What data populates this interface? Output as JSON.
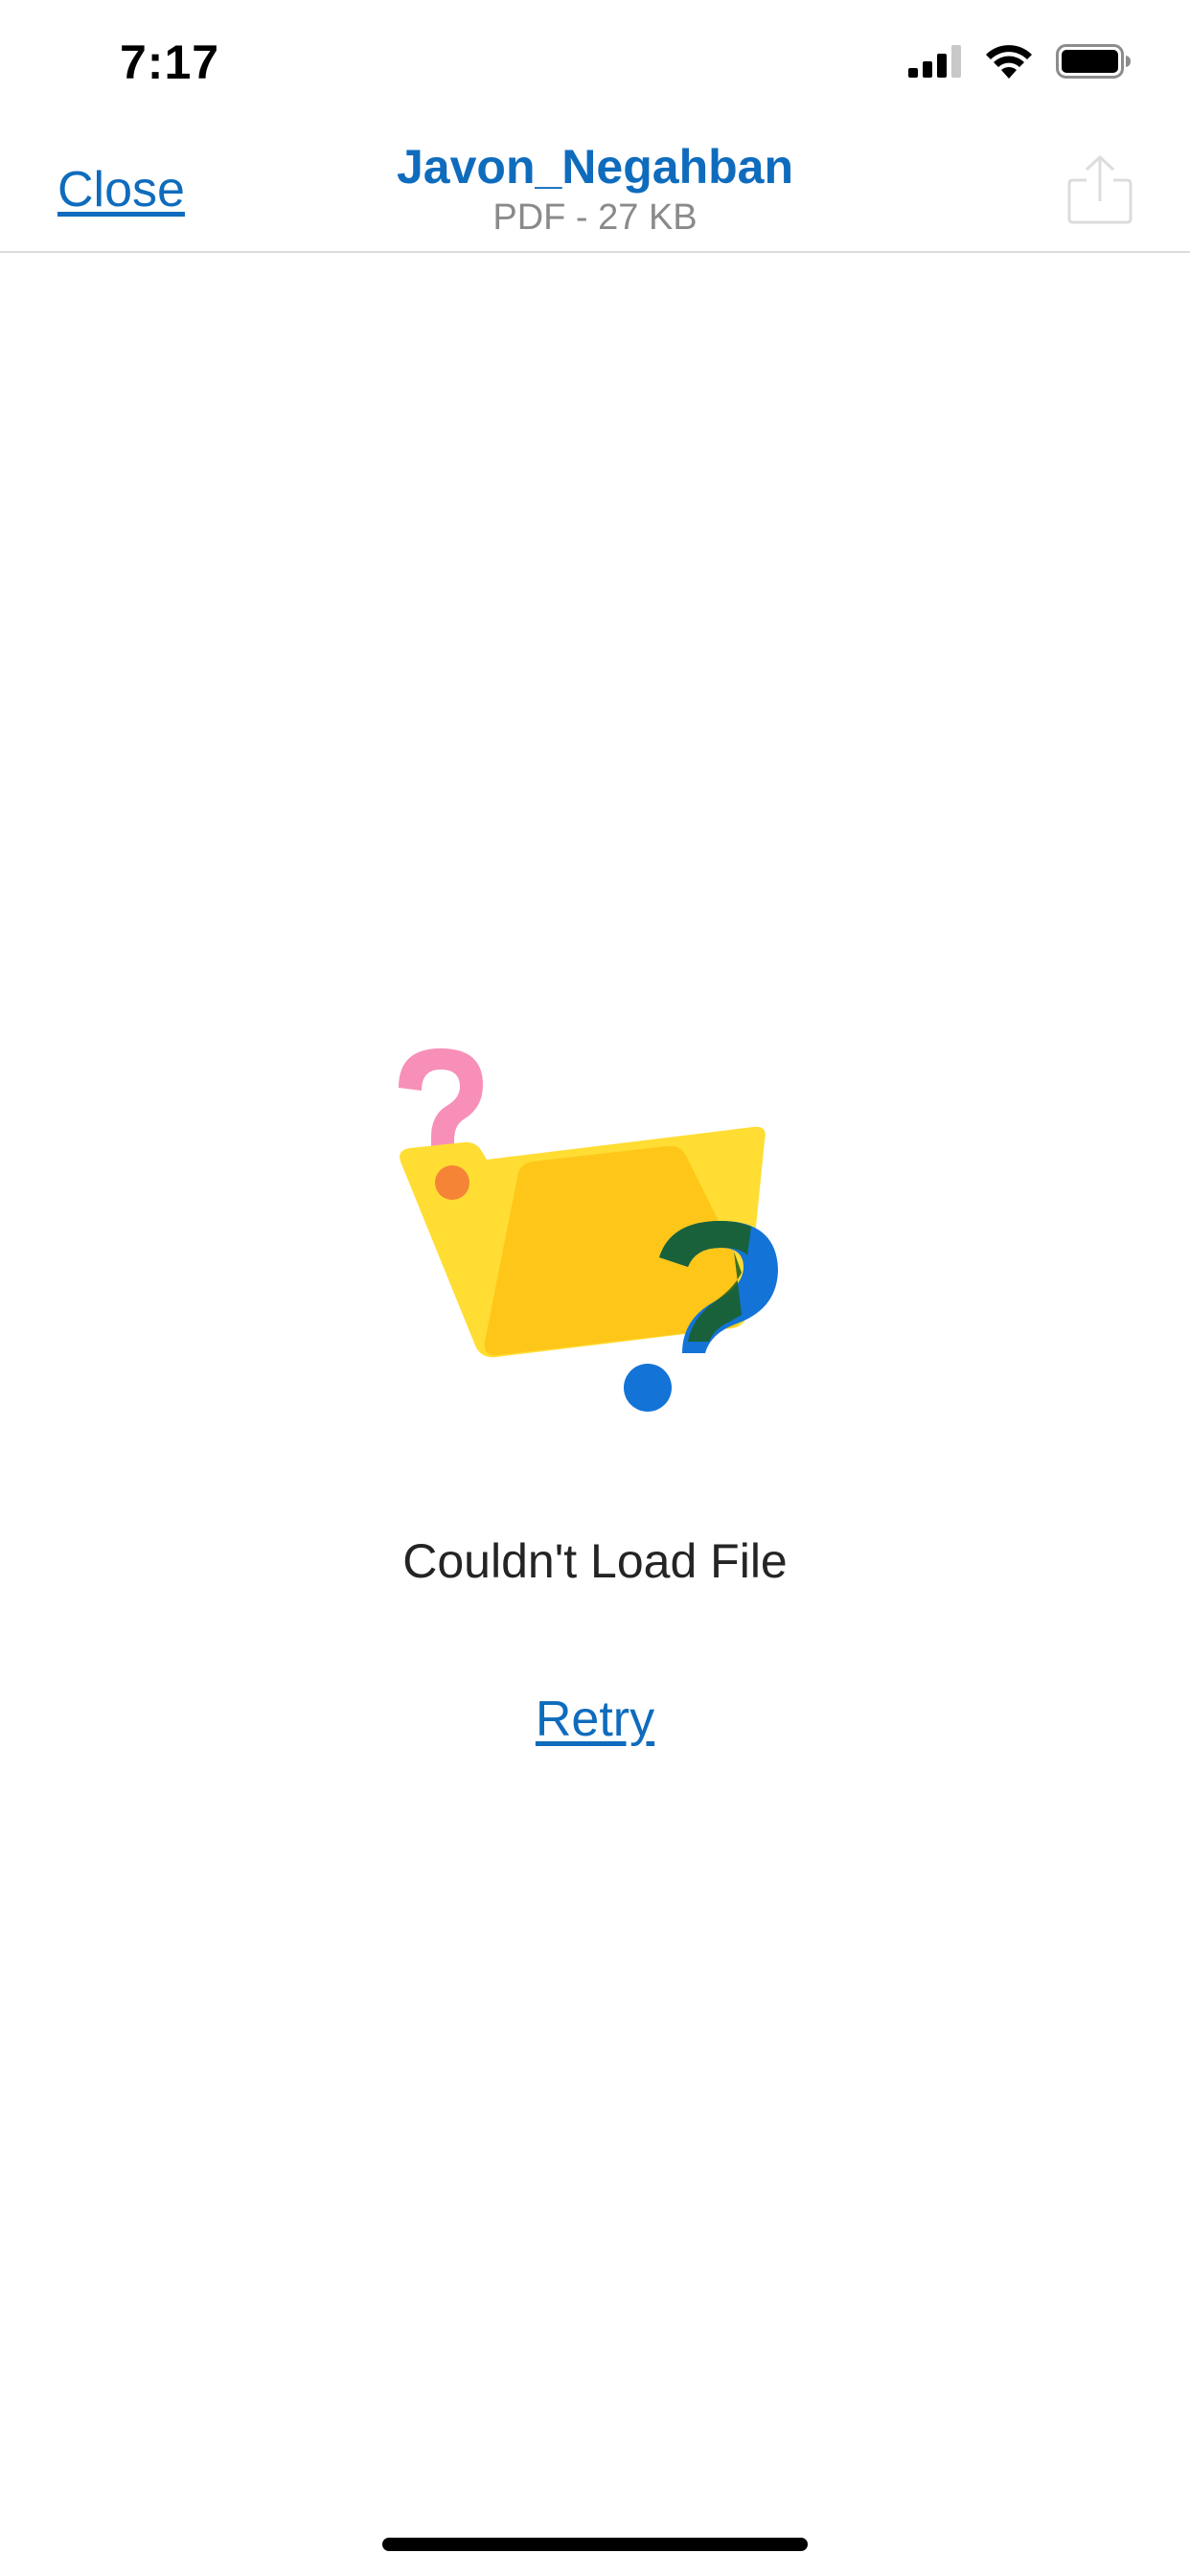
{
  "status_bar": {
    "time": "7:17",
    "signal_icon": "cellular-signal-icon",
    "wifi_icon": "wifi-icon",
    "battery_icon": "battery-icon"
  },
  "header": {
    "close_label": "Close",
    "file_name": "Javon_Negahban",
    "file_meta": "PDF - 27 KB",
    "share_icon": "share-icon"
  },
  "main": {
    "illustration_icon": "folder-question-icon",
    "error_message": "Couldn't Load File",
    "retry_label": "Retry"
  },
  "colors": {
    "accent": "#0f6cbd",
    "meta_text": "#8a8a8a",
    "body_text": "#242424"
  }
}
